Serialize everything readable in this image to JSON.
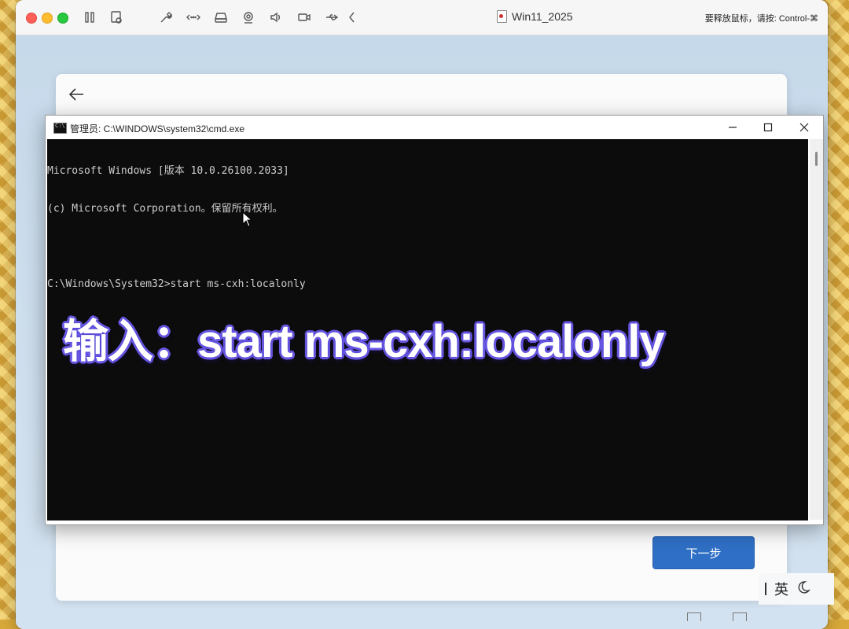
{
  "vm": {
    "title": "Win11_2025",
    "hint": "要释放鼠标，请按: Control-⌘",
    "toolbar_icons": [
      "pause-icon",
      "snapshot-icon",
      "settings-wrench-icon",
      "network-icon",
      "drive-icon",
      "camera-icon",
      "volume-icon",
      "video-icon",
      "usb-icon",
      "chevron-left-icon"
    ]
  },
  "cmd": {
    "title": "管理员: C:\\WINDOWS\\system32\\cmd.exe",
    "lines": [
      "Microsoft Windows [版本 10.0.26100.2033]",
      "(c) Microsoft Corporation。保留所有权利。",
      "",
      "C:\\Windows\\System32>start ms-cxh:localonly"
    ]
  },
  "oobe": {
    "next_label": "下一步"
  },
  "caption": "输入：start ms-cxh:localonly",
  "ime": {
    "lang": "英"
  },
  "colors": {
    "accent": "#2f6fc5",
    "console_bg": "#0c0c0c",
    "caption_outline": "#6b5be6"
  }
}
